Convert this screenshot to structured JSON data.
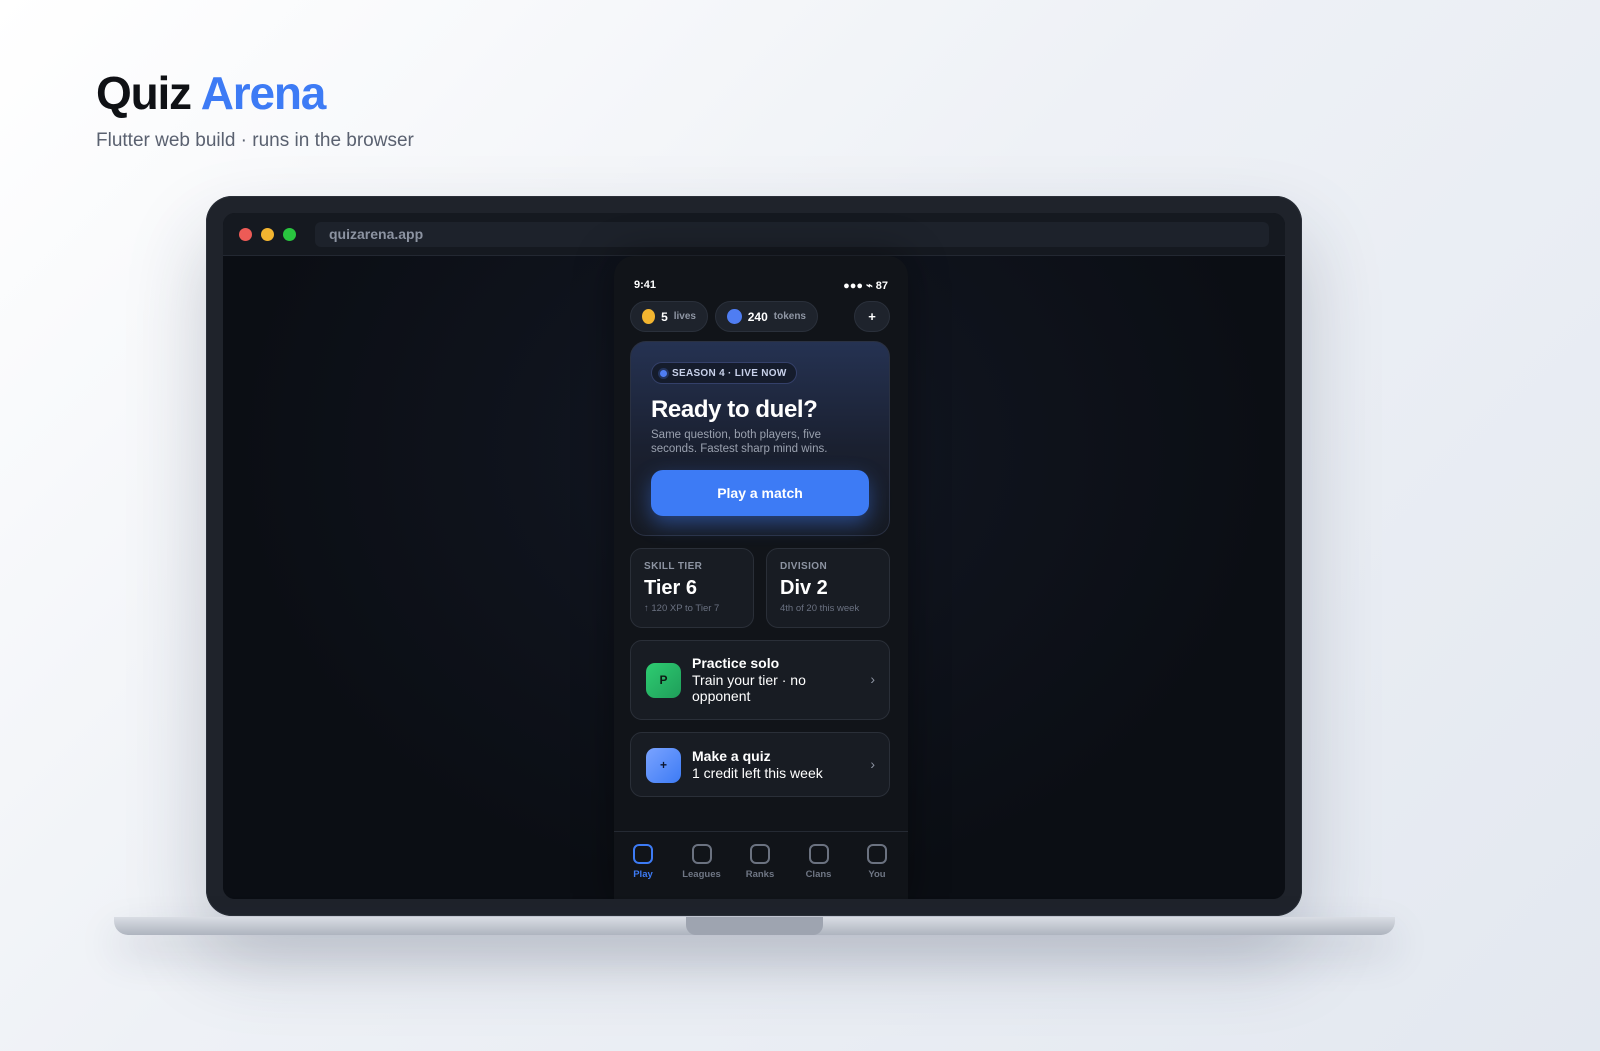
{
  "page": {
    "title_main": "Quiz",
    "title_accent": "Arena",
    "subtitle": "Flutter web build · runs in the browser"
  },
  "browser": {
    "url": "quizarena.app"
  },
  "phone": {
    "status": {
      "time": "9:41",
      "right": "●●● ⌁ 87"
    },
    "lives": {
      "value": "5",
      "unit": "lives",
      "coin_color": "#f3b530"
    },
    "tokens": {
      "value": "240",
      "unit": "tokens",
      "coin_color": "#4f7df2"
    },
    "add_label": "+",
    "hero": {
      "badge": "SEASON 4 · LIVE NOW",
      "title": "Ready to duel?",
      "description": "Same question, both players, five seconds. Fastest sharp mind wins.",
      "cta": "Play a match"
    },
    "stats": {
      "tier": {
        "label": "SKILL TIER",
        "value": "Tier 6",
        "sub": "↑ 120 XP to Tier 7"
      },
      "division": {
        "label": "DIVISION",
        "value": "Div 2",
        "sub": "4th of 20 this week"
      }
    },
    "actions": {
      "practice": {
        "icon": "P",
        "title": "Practice solo",
        "subtitle": "Train your tier · no opponent",
        "chevron": "›"
      },
      "quiz": {
        "icon": "+",
        "title": "Make a quiz",
        "subtitle": "1 credit left this week",
        "chevron": "›"
      }
    },
    "tabs": [
      {
        "label": "Play",
        "active": true
      },
      {
        "label": "Leagues",
        "active": false
      },
      {
        "label": "Ranks",
        "active": false
      },
      {
        "label": "Clans",
        "active": false
      },
      {
        "label": "You",
        "active": false
      }
    ]
  },
  "colors": {
    "accent": "#3d7bf5",
    "success": "#2ecc71"
  }
}
